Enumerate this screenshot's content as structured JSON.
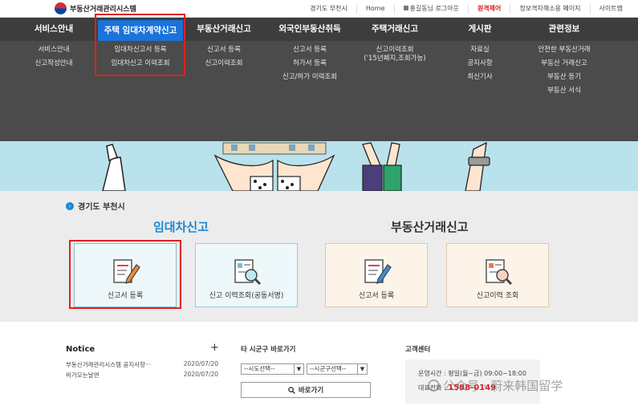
{
  "site": {
    "name": "부동산거래관리시스템"
  },
  "utility": {
    "region": "경기도 부천시",
    "home": "Home",
    "user": "홍길동님 로그아웃",
    "remote": "원격제어",
    "accessibility": "정보격차해소용 페이지",
    "sitemap": "사이트맵"
  },
  "menu": [
    {
      "label": "서비스안내",
      "items": [
        "서비스안내",
        "신고작성안내"
      ]
    },
    {
      "label": "주택 임대차계약신고",
      "items": [
        "임대차신고서 등록",
        "임대차신고 이력조회"
      ]
    },
    {
      "label": "부동산거래신고",
      "items": [
        "신고서 등록",
        "신고이력조회"
      ]
    },
    {
      "label": "외국인부동산취득",
      "items": [
        "신고서 등록",
        "허가서 등록",
        "신고/허가 이력조회"
      ]
    },
    {
      "label": "주택거래신고",
      "items": [
        "신고이력조회",
        "('15년폐지,조회가능)"
      ]
    },
    {
      "label": "게시판",
      "items": [
        "자료실",
        "공지사항",
        "최신기사"
      ]
    },
    {
      "label": "관련정보",
      "items": [
        "안전한 부동산거래",
        "부동산 거래신고",
        "부동산 등기",
        "부동산 서식"
      ]
    }
  ],
  "choose": {
    "region": "경기도 부천시",
    "lease_title": "임대차신고",
    "trade_title": "부동산거래신고",
    "cards": [
      {
        "label": "신고서 등록"
      },
      {
        "label": "신고 이력조회(공동서명)"
      },
      {
        "label": "신고서 등록"
      },
      {
        "label": "신고이력 조회"
      }
    ]
  },
  "notice": {
    "title": "Notice",
    "plus": "+",
    "rows": [
      {
        "title": "부동산거래관리시스템 공지사항···",
        "date": "2020/07/20"
      },
      {
        "title": "비가오는날엔",
        "date": "2020/07/20"
      }
    ]
  },
  "other": {
    "title": "타 시군구 바로가기",
    "sido": "--시도선택--",
    "sigungu": "--시군구선택--",
    "go": "바로가기"
  },
  "cs": {
    "title": "고객센터",
    "hours": "운영시간 : 평일(월~금) 09:00~18:00",
    "phone_label": "대표전화 :",
    "phone": "1588-0149"
  },
  "watermark": "公众号 · 蔚来韩国留学",
  "colors": {
    "accent": "#1a73d9",
    "menu_bg": "#4b4b4b",
    "highlight": "#e02020",
    "lease_title": "#1b87d6"
  }
}
